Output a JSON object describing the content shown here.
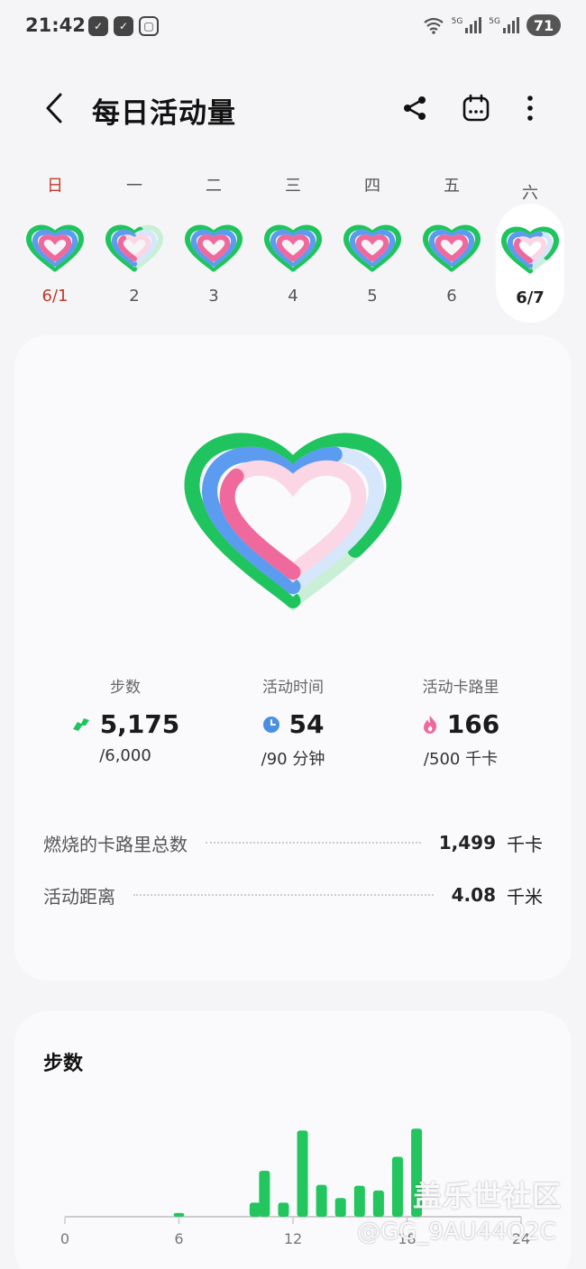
{
  "status_bar": {
    "time": "21:42",
    "battery": "71",
    "signal_label_1": "5G",
    "signal_label_2": "5G"
  },
  "header": {
    "title": "每日活动量",
    "icons": [
      "back-icon",
      "share-icon",
      "calendar-icon",
      "more-icon"
    ]
  },
  "week": {
    "days": [
      {
        "name": "日",
        "date": "6/1"
      },
      {
        "name": "一",
        "date": "2"
      },
      {
        "name": "二",
        "date": "3"
      },
      {
        "name": "三",
        "date": "4"
      },
      {
        "name": "四",
        "date": "5"
      },
      {
        "name": "五",
        "date": "6"
      },
      {
        "name": "六",
        "date": "6/7"
      }
    ],
    "selected_index": 6
  },
  "metrics": {
    "steps": {
      "label": "步数",
      "value": "5,175",
      "goal": "/6,000",
      "progress": 0.8625
    },
    "active_time": {
      "label": "活动时间",
      "value": "54",
      "goal": "/90 分钟",
      "progress": 0.6
    },
    "active_calories": {
      "label": "活动卡路里",
      "value": "166",
      "goal": "/500 千卡",
      "progress": 0.332
    }
  },
  "stats": {
    "total_calories": {
      "label": "燃烧的卡路里总数",
      "value": "1,499",
      "unit": "千卡"
    },
    "active_distance": {
      "label": "活动距离",
      "value": "4.08",
      "unit": "千米"
    }
  },
  "steps_chart": {
    "title": "步数"
  },
  "chart_data": {
    "type": "bar",
    "title": "步数",
    "x_ticks": [
      "0",
      "6",
      "12",
      "18",
      "24"
    ],
    "xlim": [
      0,
      24
    ],
    "x": [
      6,
      10,
      10.5,
      11.5,
      12.5,
      13.5,
      14.5,
      15.5,
      16.5,
      17.5,
      18.5,
      20
    ],
    "values": [
      40,
      150,
      490,
      150,
      920,
      340,
      200,
      330,
      280,
      640,
      940,
      0
    ],
    "ylim": [
      0,
      1000
    ],
    "color": "#22c55e"
  },
  "watermark": {
    "line1": "盖乐世社区",
    "line2": "@GG_9AU44O2C"
  },
  "colors": {
    "green": "#1fc45e",
    "blue": "#5b9bf0",
    "pink": "#f0699d",
    "sunday_red": "#c0392b"
  }
}
